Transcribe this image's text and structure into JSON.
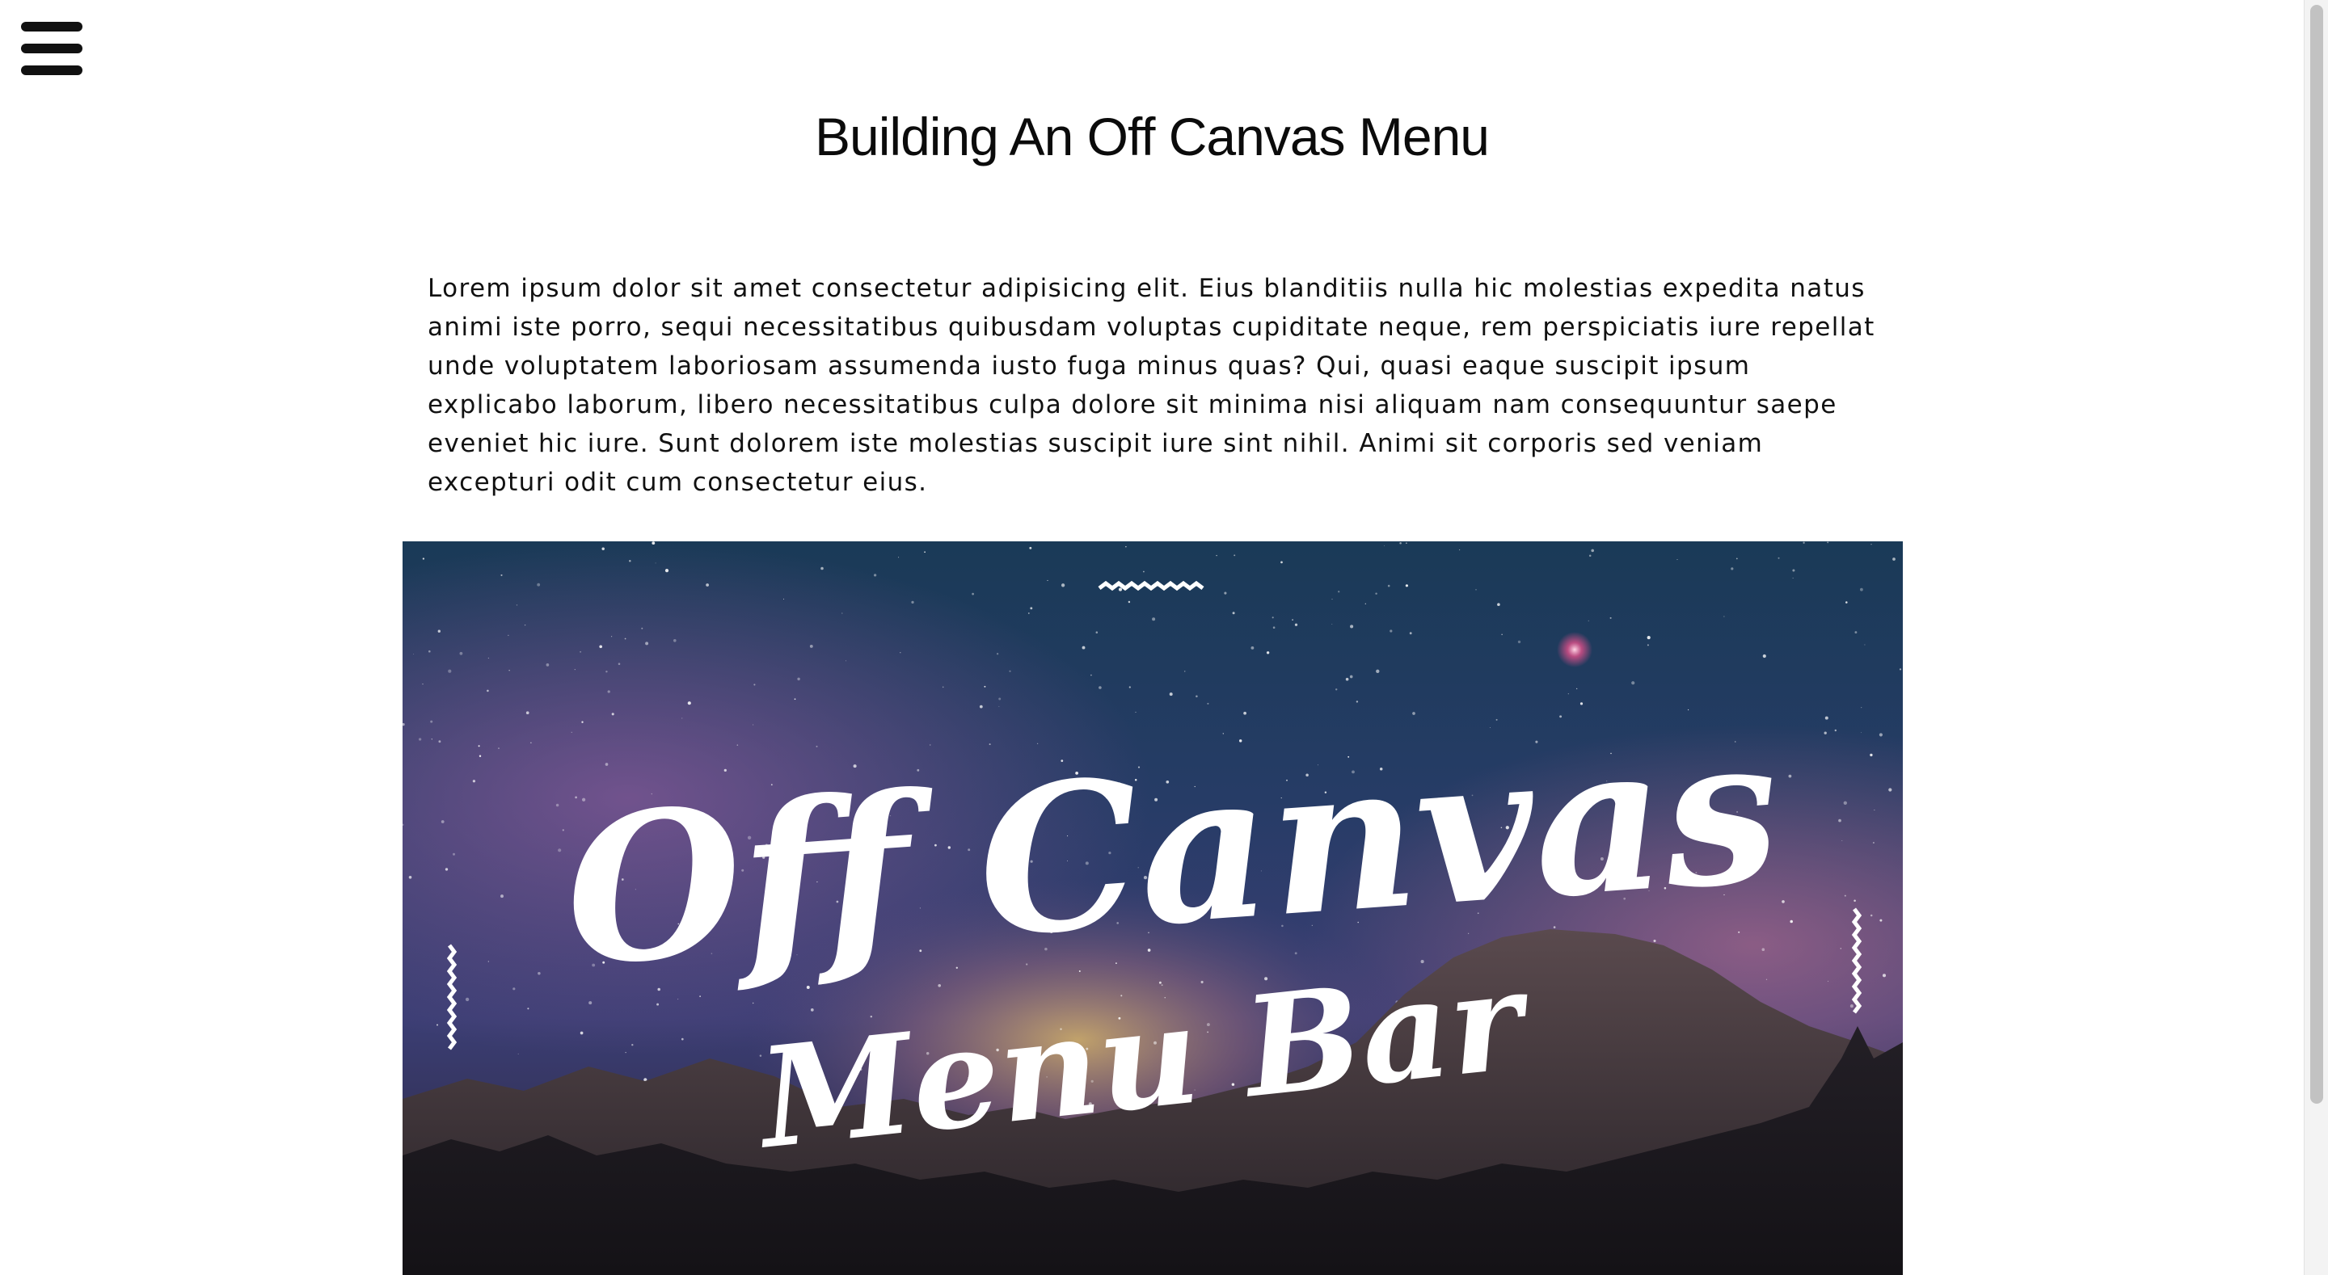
{
  "header": {
    "menu_icon": "hamburger-menu-icon",
    "title": "Building An Off Canvas Menu"
  },
  "article": {
    "paragraph": "Lorem ipsum dolor sit amet consectetur adipisicing elit. Eius blanditiis nulla hic molestias expedita natus animi iste porro, sequi necessitatibus quibusdam voluptas cupiditate neque, rem perspiciatis iure repellat unde voluptatem laboriosam assumenda iusto fuga minus quas? Qui, quasi eaque suscipit ipsum explicabo laborum, libero necessitatibus culpa dolore sit minima nisi aliquam nam consequuntur saepe eveniet hic iure. Sunt dolorem iste molestias suscipit iure sint nihil. Animi sit corporis sed veniam excepturi odit cum consectetur eius."
  },
  "hero": {
    "line1": "Off Canvas",
    "line2": "Menu Bar",
    "colors": {
      "sky_top": "#1d3f5c",
      "sky_mid": "#2b3f6b",
      "nebula": "#7a4a8a",
      "glow": "#c9a65a",
      "mountain": "#3a3236",
      "forest": "#17161a",
      "text": "#ffffff"
    }
  }
}
